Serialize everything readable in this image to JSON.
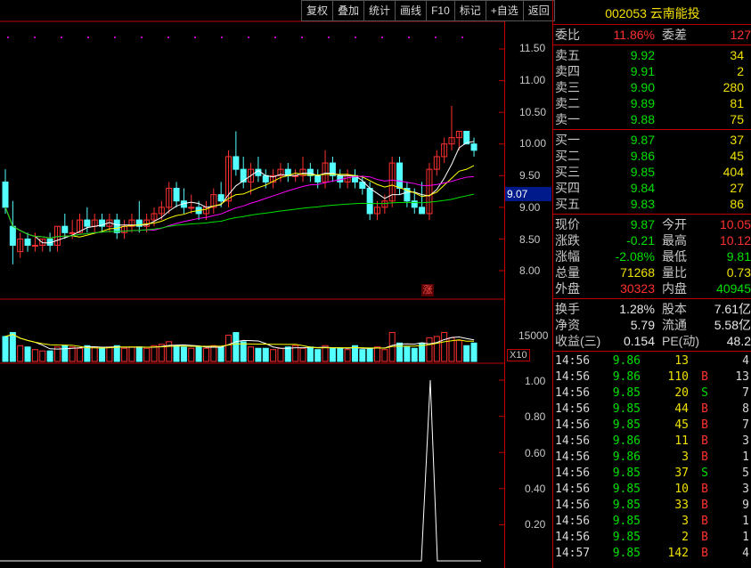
{
  "toolbar": [
    "复权",
    "叠加",
    "统计",
    "画线",
    "F10",
    "标记",
    "+自选",
    "返回"
  ],
  "stock": {
    "code": "002053",
    "name": "云南能投"
  },
  "price_axis": {
    "labels": [
      "11.50",
      "11.00",
      "10.50",
      "10.00",
      "9.50",
      "9.00",
      "8.50",
      "8.00"
    ],
    "current_tag": "9.07"
  },
  "volume_axis": {
    "label": "15000",
    "mult": "X10"
  },
  "indicator_axis": {
    "labels": [
      "1.00",
      "0.80",
      "0.60",
      "0.40",
      "0.20"
    ]
  },
  "chart_marker": "涨",
  "order_book": {
    "weibi": {
      "label": "委比",
      "value": "11.86%"
    },
    "weicha": {
      "label": "委差",
      "value": "127"
    },
    "sells": [
      {
        "label": "卖五",
        "price": "9.92",
        "vol": "34"
      },
      {
        "label": "卖四",
        "price": "9.91",
        "vol": "2"
      },
      {
        "label": "卖三",
        "price": "9.90",
        "vol": "280"
      },
      {
        "label": "卖二",
        "price": "9.89",
        "vol": "81"
      },
      {
        "label": "卖一",
        "price": "9.88",
        "vol": "75"
      }
    ],
    "buys": [
      {
        "label": "买一",
        "price": "9.87",
        "vol": "37"
      },
      {
        "label": "买二",
        "price": "9.86",
        "vol": "45"
      },
      {
        "label": "买三",
        "price": "9.85",
        "vol": "404"
      },
      {
        "label": "买四",
        "price": "9.84",
        "vol": "27"
      },
      {
        "label": "买五",
        "price": "9.83",
        "vol": "86"
      }
    ]
  },
  "quote": [
    {
      "l1": "现价",
      "v1": "9.87",
      "c1": "green",
      "l2": "今开",
      "v2": "10.05",
      "c2": "red"
    },
    {
      "l1": "涨跌",
      "v1": "-0.21",
      "c1": "green",
      "l2": "最高",
      "v2": "10.12",
      "c2": "red"
    },
    {
      "l1": "涨幅",
      "v1": "-2.08%",
      "c1": "green",
      "l2": "最低",
      "v2": "9.81",
      "c2": "green"
    },
    {
      "l1": "总量",
      "v1": "71268",
      "c1": "yellow",
      "l2": "量比",
      "v2": "0.73",
      "c2": "yellow"
    },
    {
      "l1": "外盘",
      "v1": "30323",
      "c1": "red",
      "l2": "内盘",
      "v2": "40945",
      "c2": "green"
    }
  ],
  "finance": [
    {
      "l1": "换手",
      "v1": "1.28%",
      "l2": "股本",
      "v2": "7.61亿"
    },
    {
      "l1": "净资",
      "v1": "5.79",
      "l2": "流通",
      "v2": "5.58亿"
    },
    {
      "l1": "收益(三)",
      "v1": "0.154",
      "l2": "PE(动)",
      "v2": "48.2"
    }
  ],
  "trades": [
    {
      "time": "14:56",
      "price": "9.86",
      "vol": "13",
      "side": "",
      "count": "4"
    },
    {
      "time": "14:56",
      "price": "9.86",
      "vol": "110",
      "side": "B",
      "count": "13"
    },
    {
      "time": "14:56",
      "price": "9.85",
      "vol": "20",
      "side": "S",
      "count": "7"
    },
    {
      "time": "14:56",
      "price": "9.85",
      "vol": "44",
      "side": "B",
      "count": "8"
    },
    {
      "time": "14:56",
      "price": "9.85",
      "vol": "45",
      "side": "B",
      "count": "7"
    },
    {
      "time": "14:56",
      "price": "9.86",
      "vol": "11",
      "side": "B",
      "count": "3"
    },
    {
      "time": "14:56",
      "price": "9.86",
      "vol": "3",
      "side": "B",
      "count": "1"
    },
    {
      "time": "14:56",
      "price": "9.85",
      "vol": "37",
      "side": "S",
      "count": "5"
    },
    {
      "time": "14:56",
      "price": "9.85",
      "vol": "10",
      "side": "B",
      "count": "3"
    },
    {
      "time": "14:56",
      "price": "9.85",
      "vol": "33",
      "side": "B",
      "count": "9"
    },
    {
      "time": "14:56",
      "price": "9.85",
      "vol": "3",
      "side": "B",
      "count": "1"
    },
    {
      "time": "14:56",
      "price": "9.85",
      "vol": "2",
      "side": "B",
      "count": "1"
    },
    {
      "time": "14:57",
      "price": "9.85",
      "vol": "142",
      "side": "B",
      "count": "4"
    }
  ],
  "colors": {
    "up": "#ff3030",
    "down": "#54ffff",
    "ma5": "#ffffff",
    "ma10": "#ffff00",
    "ma20": "#ff00ff",
    "ma60": "#00e000",
    "grid": "#c00000"
  },
  "chart_data": {
    "type": "candlestick",
    "ylim": [
      7.9,
      11.6
    ],
    "candles": [
      [
        9.4,
        9.6,
        8.9,
        9.0
      ],
      [
        8.7,
        9.1,
        8.1,
        8.4
      ],
      [
        8.3,
        8.6,
        8.2,
        8.5
      ],
      [
        8.5,
        8.6,
        8.3,
        8.4
      ],
      [
        8.4,
        8.6,
        8.3,
        8.4
      ],
      [
        8.4,
        8.5,
        8.3,
        8.5
      ],
      [
        8.5,
        8.6,
        8.3,
        8.4
      ],
      [
        8.4,
        8.7,
        8.3,
        8.7
      ],
      [
        8.7,
        8.9,
        8.5,
        8.6
      ],
      [
        8.6,
        8.8,
        8.5,
        8.6
      ],
      [
        8.6,
        8.9,
        8.6,
        8.8
      ],
      [
        8.8,
        9.0,
        8.6,
        8.7
      ],
      [
        8.7,
        8.9,
        8.6,
        8.8
      ],
      [
        8.8,
        8.9,
        8.6,
        8.7
      ],
      [
        8.7,
        8.9,
        8.6,
        8.8
      ],
      [
        8.8,
        8.9,
        8.5,
        8.6
      ],
      [
        8.6,
        8.8,
        8.5,
        8.7
      ],
      [
        8.7,
        8.9,
        8.6,
        8.8
      ],
      [
        8.8,
        9.1,
        8.6,
        8.7
      ],
      [
        8.7,
        8.9,
        8.6,
        8.8
      ],
      [
        8.8,
        9.0,
        8.7,
        8.9
      ],
      [
        8.9,
        9.1,
        8.8,
        9.0
      ],
      [
        9.0,
        9.4,
        8.9,
        9.3
      ],
      [
        9.3,
        9.4,
        9.0,
        9.1
      ],
      [
        9.1,
        9.3,
        8.9,
        9.0
      ],
      [
        9.0,
        9.2,
        8.9,
        9.0
      ],
      [
        9.0,
        9.1,
        8.8,
        8.9
      ],
      [
        8.9,
        9.1,
        8.8,
        9.0
      ],
      [
        9.0,
        9.3,
        8.9,
        9.2
      ],
      [
        9.2,
        9.4,
        9.0,
        9.1
      ],
      [
        9.1,
        9.9,
        9.0,
        9.8
      ],
      [
        9.8,
        10.2,
        9.5,
        9.6
      ],
      [
        9.6,
        9.8,
        9.3,
        9.4
      ],
      [
        9.4,
        9.7,
        9.2,
        9.6
      ],
      [
        9.6,
        9.8,
        9.4,
        9.5
      ],
      [
        9.5,
        9.6,
        9.3,
        9.4
      ],
      [
        9.4,
        9.6,
        9.3,
        9.5
      ],
      [
        9.5,
        9.7,
        9.4,
        9.6
      ],
      [
        9.6,
        9.7,
        9.4,
        9.5
      ],
      [
        9.5,
        9.6,
        9.4,
        9.5
      ],
      [
        9.5,
        9.8,
        9.4,
        9.6
      ],
      [
        9.6,
        9.7,
        9.4,
        9.5
      ],
      [
        9.5,
        9.6,
        9.3,
        9.4
      ],
      [
        9.4,
        9.9,
        9.3,
        9.7
      ],
      [
        9.7,
        9.8,
        9.4,
        9.5
      ],
      [
        9.5,
        9.6,
        9.3,
        9.4
      ],
      [
        9.4,
        9.6,
        9.3,
        9.5
      ],
      [
        9.5,
        9.6,
        9.3,
        9.4
      ],
      [
        9.4,
        9.5,
        9.2,
        9.3
      ],
      [
        9.3,
        9.4,
        8.8,
        8.9
      ],
      [
        8.9,
        9.1,
        8.8,
        9.0
      ],
      [
        9.0,
        9.2,
        8.9,
        9.1
      ],
      [
        9.1,
        9.8,
        9.0,
        9.7
      ],
      [
        9.7,
        9.8,
        9.2,
        9.3
      ],
      [
        9.3,
        9.4,
        9.0,
        9.1
      ],
      [
        9.1,
        9.3,
        8.9,
        9.0
      ],
      [
        9.0,
        9.4,
        8.9,
        8.9
      ],
      [
        8.9,
        9.7,
        8.8,
        9.6
      ],
      [
        9.6,
        9.9,
        9.5,
        9.8
      ],
      [
        9.8,
        10.1,
        9.7,
        10.0
      ],
      [
        10.0,
        10.6,
        9.9,
        10.1
      ],
      [
        10.1,
        10.2,
        9.9,
        10.2
      ],
      [
        10.2,
        10.2,
        10.0,
        10.0
      ],
      [
        10.0,
        10.1,
        9.8,
        9.9
      ]
    ],
    "volumes": [
      95,
      110,
      60,
      55,
      45,
      40,
      40,
      55,
      60,
      55,
      50,
      60,
      55,
      50,
      55,
      60,
      50,
      55,
      55,
      50,
      60,
      65,
      75,
      60,
      55,
      50,
      55,
      50,
      60,
      55,
      100,
      110,
      75,
      55,
      50,
      50,
      45,
      50,
      55,
      60,
      50,
      55,
      45,
      60,
      50,
      50,
      45,
      60,
      45,
      50,
      55,
      45,
      110,
      70,
      55,
      50,
      70,
      90,
      95,
      110,
      90,
      80,
      60,
      70
    ]
  }
}
